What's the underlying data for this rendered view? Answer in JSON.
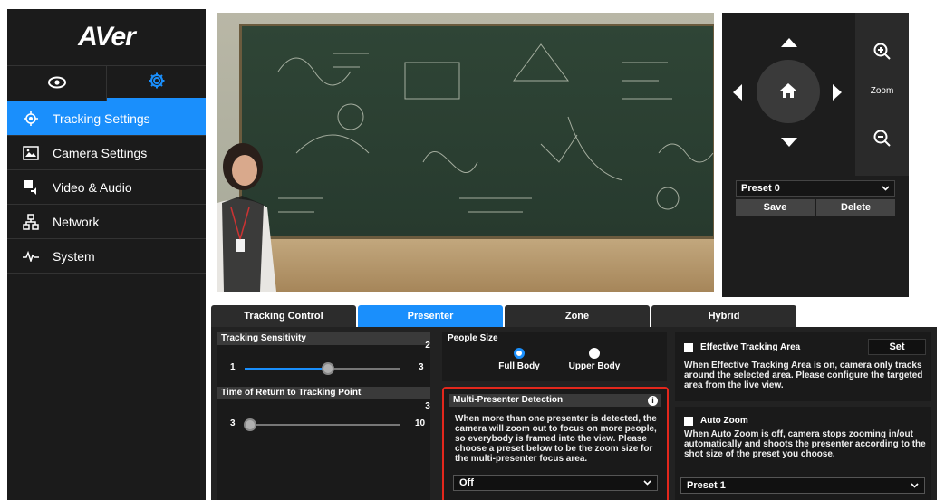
{
  "brand": {
    "logo": "AVer"
  },
  "mode_tabs": [
    {
      "name": "view",
      "icon": "eye-icon"
    },
    {
      "name": "settings",
      "icon": "gear-icon"
    }
  ],
  "sidebar": {
    "items": [
      {
        "label": "Tracking Settings",
        "icon": "target-icon",
        "active": true
      },
      {
        "label": "Camera Settings",
        "icon": "image-icon",
        "active": false
      },
      {
        "label": "Video & Audio",
        "icon": "video-audio-icon",
        "active": false
      },
      {
        "label": "Network",
        "icon": "network-icon",
        "active": false
      },
      {
        "label": "System",
        "icon": "pulse-icon",
        "active": false
      }
    ]
  },
  "ptz": {
    "zoom_label": "Zoom",
    "preset_value": "Preset 0",
    "save_label": "Save",
    "delete_label": "Delete"
  },
  "tabs": [
    {
      "label": "Tracking Control",
      "active": false
    },
    {
      "label": "Presenter",
      "active": true
    },
    {
      "label": "Zone",
      "active": false
    },
    {
      "label": "Hybrid",
      "active": false
    }
  ],
  "tracking_sensitivity": {
    "title": "Tracking Sensitivity",
    "value": "2",
    "min": "1",
    "max": "3",
    "level": 0.5
  },
  "return_time": {
    "title": "Time of Return to Tracking Point",
    "value": "3",
    "min": "3",
    "max": "10",
    "level": 0.0
  },
  "people_size": {
    "title": "People Size",
    "options": [
      {
        "label": "Full Body",
        "selected": true
      },
      {
        "label": "Upper Body",
        "selected": false
      }
    ]
  },
  "multi_presenter": {
    "title": "Multi-Presenter Detection",
    "description": "When more than one presenter is detected, the camera will zoom out to focus on more people, so everybody is framed into the view. Please choose a preset below to be the zoom size for the multi-presenter focus area.",
    "select_value": "Off"
  },
  "effective_area": {
    "label": "Effective Tracking Area",
    "set_label": "Set",
    "description": "When Effective Tracking Area is on, camera only tracks around the selected area. Please configure the targeted area from the live view."
  },
  "auto_zoom": {
    "label": "Auto Zoom",
    "description": "When Auto Zoom is off, camera stops zooming in/out automatically and shoots the presenter according to the shot size of the preset you choose.",
    "select_value": "Preset 1"
  },
  "colors": {
    "accent": "#1a8ffc",
    "highlight_border": "#e3271c"
  }
}
